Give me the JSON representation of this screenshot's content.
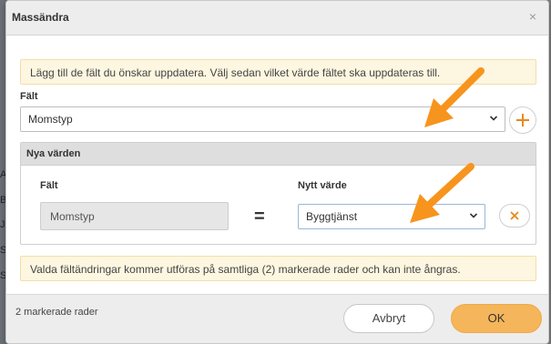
{
  "dialog": {
    "title": "Massändra",
    "close_glyph": "×"
  },
  "info_top": "Lägg till de fält du önskar uppdatera. Välj sedan vilket värde fältet ska uppdateras till.",
  "field_section": {
    "label": "Fält",
    "selected_value": "Momstyp",
    "add_glyph": "+"
  },
  "new_values_panel": {
    "title": "Nya värden",
    "field_label": "Fält",
    "field_value": "Momstyp",
    "equals": "=",
    "new_value_label": "Nytt värde",
    "new_value_selected": "Byggtjänst",
    "remove_glyph": "×"
  },
  "info_bottom": "Valda fältändringar kommer utföras på samtliga (2) markerade rader och kan inte ångras.",
  "footer": {
    "status": "2 markerade rader",
    "cancel_label": "Avbryt",
    "ok_label": "OK"
  },
  "backdrop_letters": [
    "A",
    "B",
    "J",
    "S",
    "S"
  ],
  "colors": {
    "accent_orange": "#f5b55a",
    "arrow_orange": "#f7941d",
    "plus_orange": "#e8891a",
    "info_background": "#fdf6e0"
  },
  "icons": {
    "add": "plus-icon",
    "remove": "close-icon",
    "dropdown": "chevron-down-icon",
    "annotation": "arrow-annotation"
  }
}
